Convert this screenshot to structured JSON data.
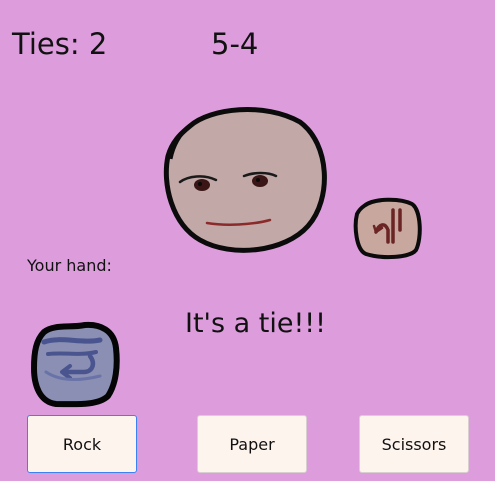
{
  "scoreboard": {
    "ties_text": "Ties: 2",
    "score_text": "5-4"
  },
  "player": {
    "hand_label": "Your hand:",
    "hand_icon": "rock-fist-icon"
  },
  "opponent": {
    "face_icon": "opponent-face-icon",
    "hand_icon": "fist-icon"
  },
  "result_text": "It's a tie!!!",
  "buttons": {
    "rock": "Rock",
    "paper": "Paper",
    "scissors": "Scissors",
    "selected": "rock"
  },
  "colors": {
    "background": "#dd9ddd",
    "button_bg": "#fdf4ee",
    "selected_border": "#3b82f6",
    "face_fill": "#c2a8a7",
    "rock_fill": "#8a8fb3"
  }
}
